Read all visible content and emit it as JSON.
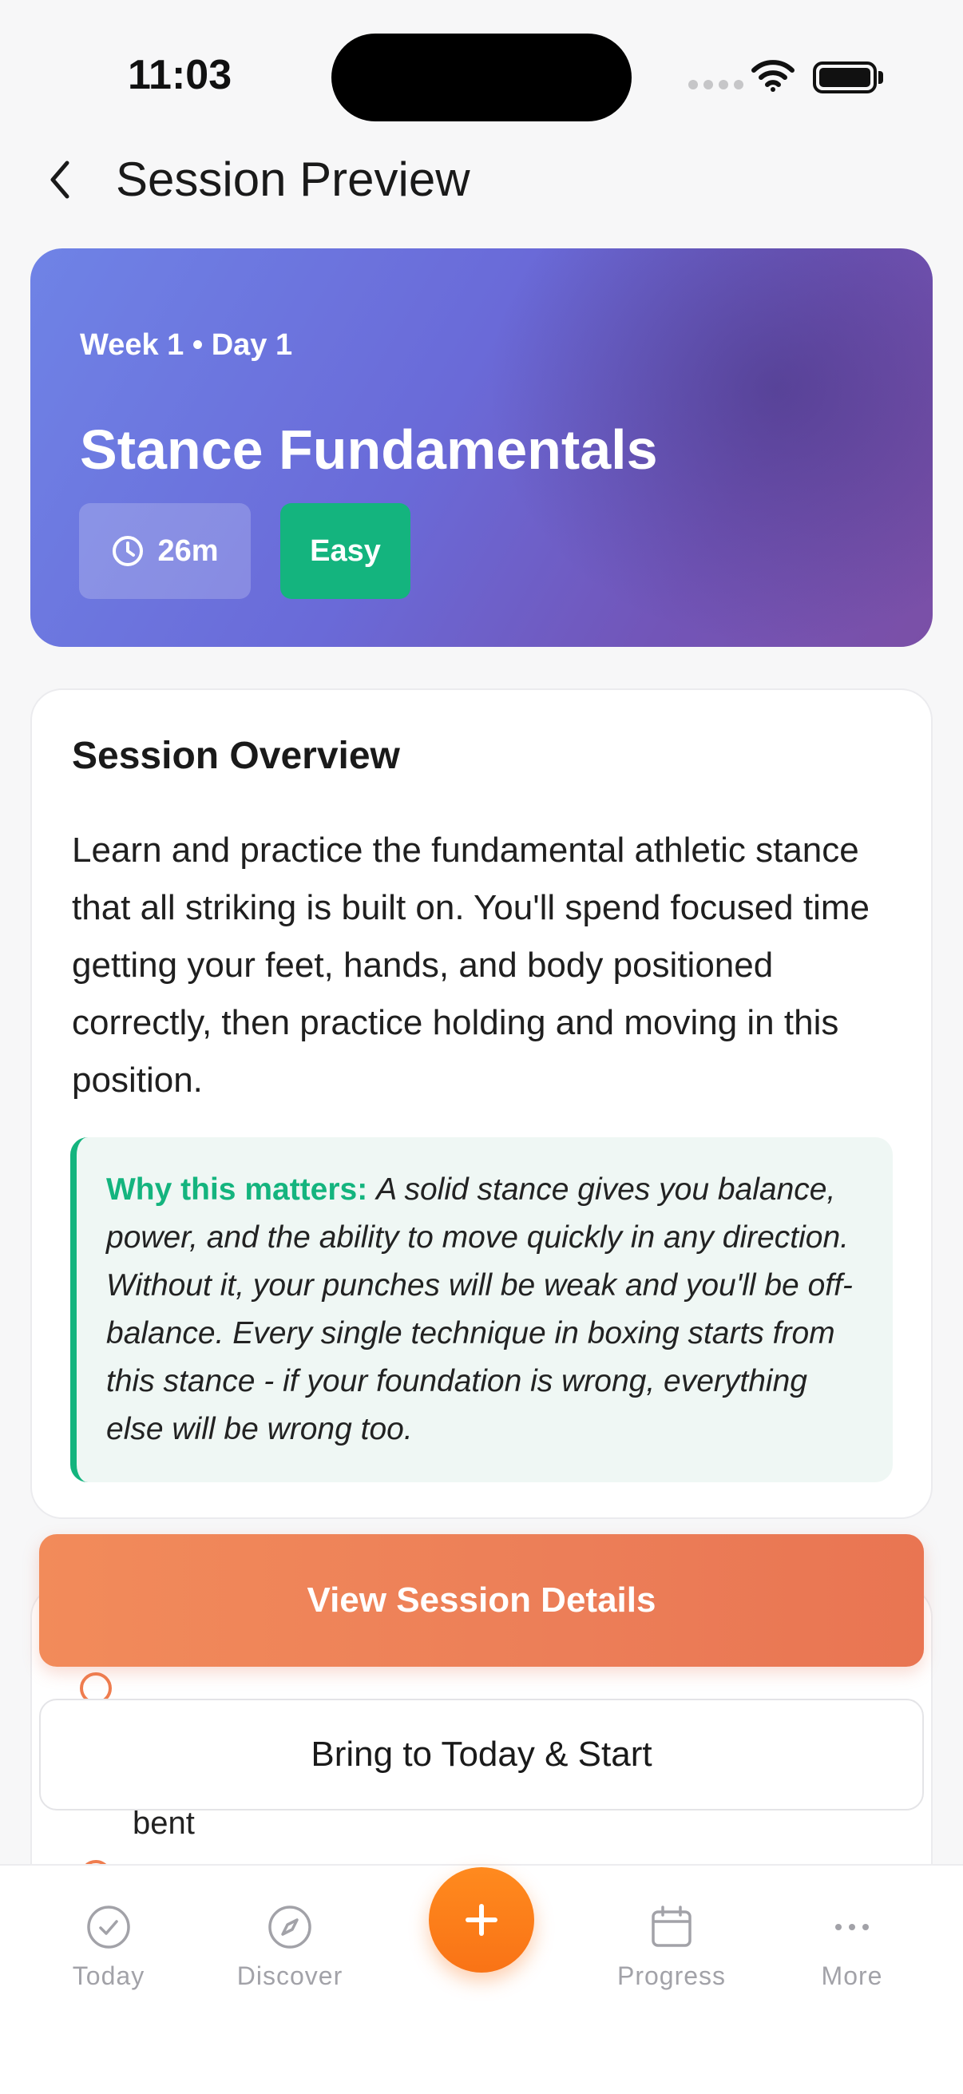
{
  "status_bar": {
    "time": "11:03"
  },
  "header": {
    "title": "Session Preview",
    "back_icon": "chevron-left-icon"
  },
  "hero": {
    "week_day": "Week 1 • Day 1",
    "title": "Stance Fundamentals",
    "duration": "26m",
    "duration_icon": "clock-icon",
    "difficulty": "Easy",
    "gradient_colors": [
      "#6f83e6",
      "#7b4fa6"
    ],
    "difficulty_color": "#14b47e"
  },
  "overview": {
    "title": "Session Overview",
    "description": "Learn and practice the fundamental athletic stance that all striking is built on. You'll spend focused time getting your feet, hands, and body positioned correctly, then practice holding and moving in this position.",
    "why_label": "Why this matters:",
    "why_text": "A solid stance gives you balance, power, and the ability to move quickly in any direction. Without it, your punches will be weak and you'll be off-balance. Every single technique in boxing starts from this stance - if your foundation is wrong, everything else will be wrong too.",
    "accent_color": "#14b47e"
  },
  "list_peek": {
    "items": [
      "bent"
    ]
  },
  "actions": {
    "primary_label": "View Session Details",
    "secondary_label": "Bring to Today & Start",
    "primary_color": "#ec7e58"
  },
  "tab_bar": {
    "tabs": [
      {
        "label": "Today",
        "icon": "check-circle-icon"
      },
      {
        "label": "Discover",
        "icon": "compass-icon"
      },
      {
        "label": "Progress",
        "icon": "calendar-icon"
      },
      {
        "label": "More",
        "icon": "more-dots-icon"
      }
    ],
    "fab_icon": "plus-icon",
    "fab_color": "#f97316"
  }
}
